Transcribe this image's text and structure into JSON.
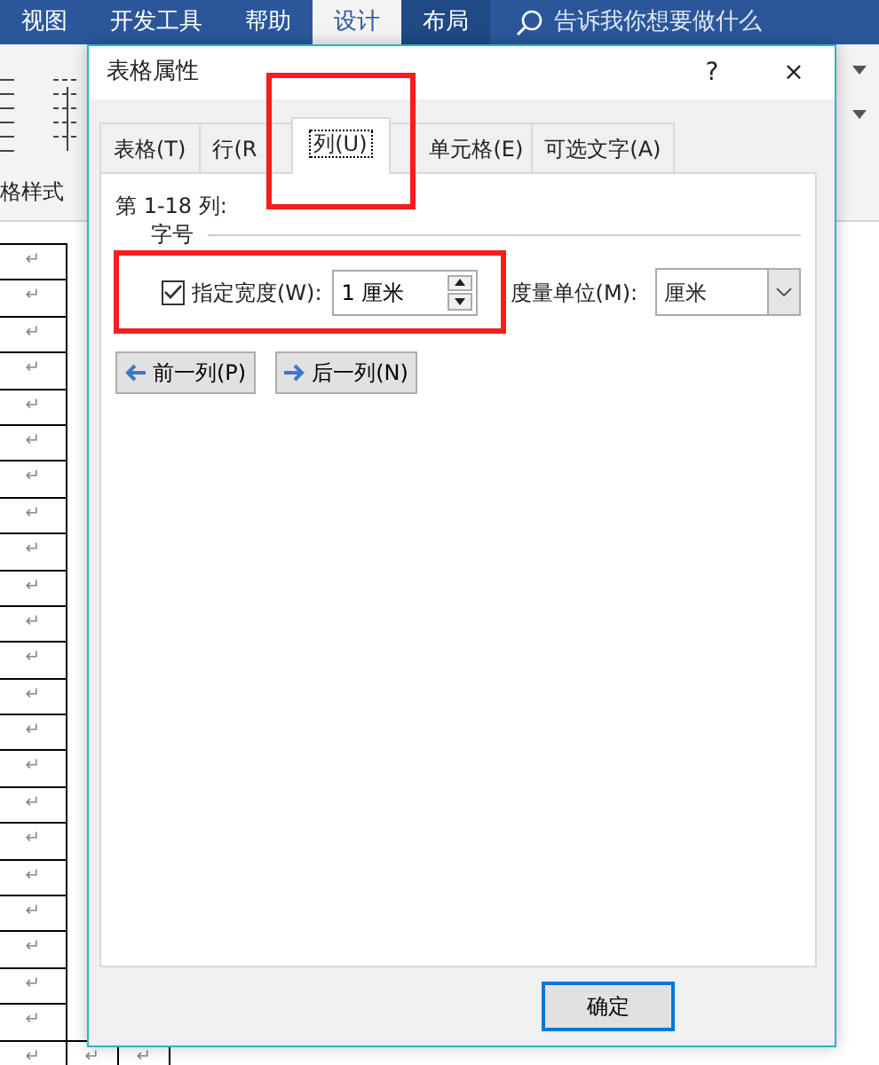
{
  "ribbon": {
    "tabs": [
      {
        "label": "视图",
        "selected": false,
        "kind": "standard"
      },
      {
        "label": "开发工具",
        "selected": false,
        "kind": "standard"
      },
      {
        "label": "帮助",
        "selected": false,
        "kind": "standard"
      },
      {
        "label": "设计",
        "selected": true,
        "kind": "contextual"
      },
      {
        "label": "布局",
        "selected": false,
        "kind": "contextual"
      }
    ],
    "search": {
      "placeholder": "告诉我你想要做什么"
    },
    "group_label": "格样式"
  },
  "document": {
    "rows": [
      [
        "↵"
      ],
      [
        "↵"
      ],
      [
        "↵"
      ],
      [
        "↵"
      ],
      [
        "↵"
      ],
      [
        "↵"
      ],
      [
        "↵"
      ],
      [
        "↵"
      ],
      [
        "↵"
      ],
      [
        "↵"
      ],
      [
        "↵"
      ],
      [
        "↵"
      ],
      [
        "↵"
      ],
      [
        "↵"
      ],
      [
        "↵"
      ],
      [
        "↵"
      ],
      [
        "↵"
      ],
      [
        "↵"
      ],
      [
        "↵"
      ],
      [
        "↵"
      ],
      [
        "↵"
      ],
      [
        "↵"
      ],
      [
        "↵",
        "↵",
        "↵"
      ]
    ]
  },
  "dialog": {
    "title": "表格属性",
    "help": "?",
    "close": "×",
    "tabs": [
      {
        "label": "表格(T)",
        "selected": false,
        "highlighted": false
      },
      {
        "label": "行(R",
        "selected": false,
        "highlighted": false
      },
      {
        "label": "列(U)",
        "selected": true,
        "highlighted": true
      },
      {
        "label": "单元格(E)",
        "selected": false,
        "highlighted": false
      },
      {
        "label": "可选文字(A)",
        "selected": false,
        "highlighted": false
      }
    ],
    "range_label": "第 1-18 列:",
    "group_label": "字号",
    "width": {
      "checked": true,
      "highlighted": true,
      "label": "指定宽度(W):",
      "value": "1 厘米"
    },
    "unit": {
      "label": "度量单位(M):",
      "value": "厘米"
    },
    "nav_buttons": [
      {
        "label": "前一列(P)",
        "kind": "left"
      },
      {
        "label": "后一列(N)",
        "kind": "right"
      }
    ],
    "ok_button": "确定"
  }
}
